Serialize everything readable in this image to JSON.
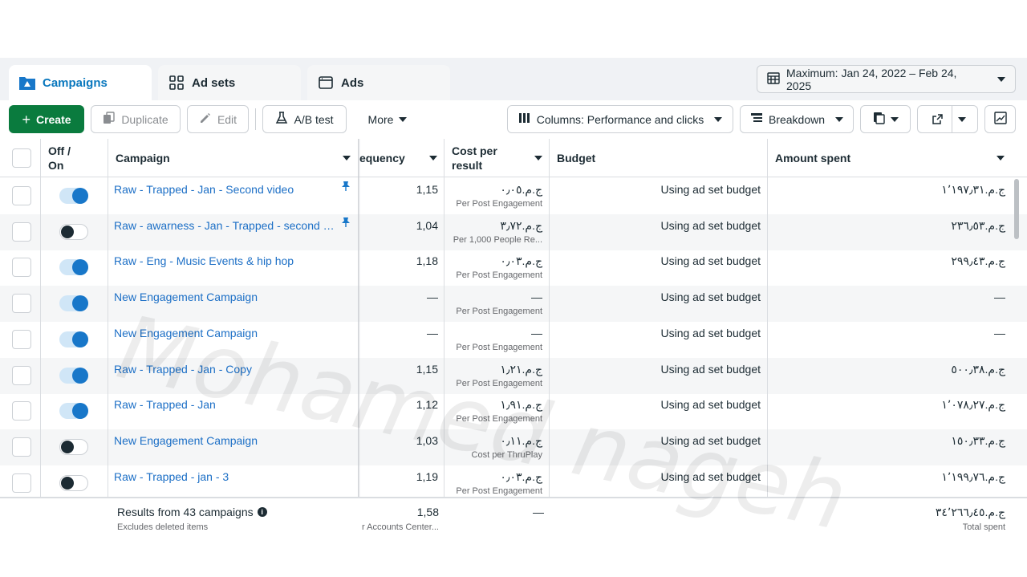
{
  "tabs": [
    {
      "label": "Campaigns",
      "icon": "campaigns-icon",
      "active": true
    },
    {
      "label": "Ad sets",
      "icon": "grid-icon",
      "active": false
    },
    {
      "label": "Ads",
      "icon": "ad-window-icon",
      "active": false
    }
  ],
  "date_range": {
    "label": "Maximum: Jan 24, 2022 – Feb 24, 2025",
    "icon": "calendar-icon"
  },
  "toolbar": {
    "create": "Create",
    "duplicate": "Duplicate",
    "edit": "Edit",
    "ab_test": "A/B test",
    "more": "More",
    "columns": "Columns: Performance and clicks",
    "breakdown": "Breakdown"
  },
  "columns": {
    "off_on": "Off /\nOn",
    "off_label": "Off /",
    "on_label": "On",
    "campaign": "Campaign",
    "frequency": "equency",
    "cost_per_result_1": "Cost per",
    "cost_per_result_2": "result",
    "budget": "Budget",
    "amount_spent": "Amount spent"
  },
  "rows": [
    {
      "name": "Raw - Trapped - Jan - Second video",
      "on": true,
      "pinned": true,
      "frequency": "1,15",
      "cost": "ج.م.٠٫٠٥",
      "cost_sub": "Per Post Engagement",
      "budget": "Using ad set budget",
      "spent": "ج.م.١٬١٩٧٫٣١"
    },
    {
      "name": "Raw - awarness - Jan - Trapped - second Vi...",
      "on": false,
      "pinned": true,
      "frequency": "1,04",
      "cost": "ج.م.٣٫٧٢",
      "cost_sub": "Per 1,000 People Re...",
      "budget": "Using ad set budget",
      "spent": "ج.م.٢٣٦٫٥٣"
    },
    {
      "name": "Raw - Eng - Music Events & hip hop",
      "on": true,
      "pinned": false,
      "frequency": "1,18",
      "cost": "ج.م.٠٫٠٣",
      "cost_sub": "Per Post Engagement",
      "budget": "Using ad set budget",
      "spent": "ج.م.٢٩٩٫٤٣"
    },
    {
      "name": "New Engagement Campaign",
      "on": true,
      "pinned": false,
      "frequency": "—",
      "cost": "—",
      "cost_sub": "Per Post Engagement",
      "budget": "Using ad set budget",
      "spent": "—"
    },
    {
      "name": "New Engagement Campaign",
      "on": true,
      "pinned": false,
      "frequency": "—",
      "cost": "—",
      "cost_sub": "Per Post Engagement",
      "budget": "Using ad set budget",
      "spent": "—"
    },
    {
      "name": "Raw - Trapped - Jan - Copy",
      "on": true,
      "pinned": false,
      "frequency": "1,15",
      "cost": "ج.م.١٫٢١",
      "cost_sub": "Per Post Engagement",
      "budget": "Using ad set budget",
      "spent": "ج.م.٥٠٠٫٣٨"
    },
    {
      "name": "Raw - Trapped - Jan",
      "on": true,
      "pinned": false,
      "frequency": "1,12",
      "cost": "ج.م.١٫٩١",
      "cost_sub": "Per Post Engagement",
      "budget": "Using ad set budget",
      "spent": "ج.م.١٬٠٧٨٫٢٧"
    },
    {
      "name": "New Engagement Campaign",
      "on": false,
      "pinned": false,
      "frequency": "1,03",
      "cost": "ج.م.٠٫١١",
      "cost_sub": "Cost per ThruPlay",
      "budget": "Using ad set budget",
      "spent": "ج.م.١٥٠٫٣٣"
    },
    {
      "name": "Raw - Trapped - jan - 3",
      "on": false,
      "pinned": false,
      "frequency": "1,19",
      "cost": "ج.م.٠٫٠٣",
      "cost_sub": "Per Post Engagement",
      "budget": "Using ad set budget",
      "spent": "ج.م.١٬١٩٩٫٧٦"
    }
  ],
  "footer": {
    "results": "Results from 43 campaigns",
    "excludes": "Excludes deleted items",
    "frequency": "1,58",
    "frequency_sub": "r Accounts Center...",
    "cost": "—",
    "spent": "ج.م.٣٤٬٢٦٦٫٤٥",
    "spent_sub": "Total spent"
  },
  "watermark": "Mohamed nageh",
  "colors": {
    "accent": "#0a78be",
    "create": "#0a7b3e",
    "link": "#1c6fc6",
    "toggle_on": "#1877c9"
  }
}
